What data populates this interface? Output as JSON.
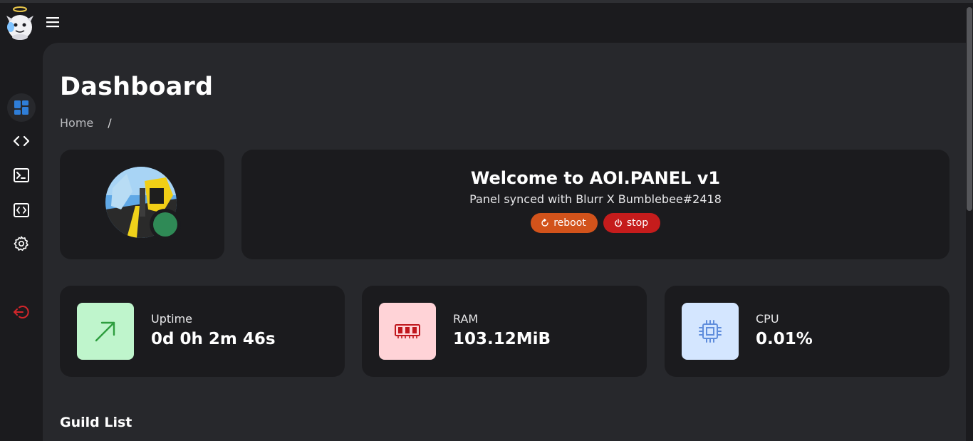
{
  "app": {
    "logo_name": "angel-bot-logo"
  },
  "topbar": {
    "menu_icon": "hamburger-menu-icon"
  },
  "sidebar": {
    "items": [
      {
        "name": "dashboard",
        "icon": "dashboard-grid-icon",
        "active": true
      },
      {
        "name": "code",
        "icon": "code-brackets-icon",
        "active": false
      },
      {
        "name": "terminal",
        "icon": "terminal-icon",
        "active": false
      },
      {
        "name": "code-editor",
        "icon": "code-file-icon",
        "active": false
      },
      {
        "name": "settings",
        "icon": "gear-icon",
        "active": false
      },
      {
        "name": "logout",
        "icon": "logout-icon",
        "active": false
      }
    ]
  },
  "page": {
    "title": "Dashboard",
    "breadcrumb": {
      "home": "Home",
      "separator": "/"
    }
  },
  "profile": {
    "status": "online",
    "status_color": "#2f8a56"
  },
  "welcome": {
    "title": "Welcome to AOI.PANEL v1",
    "subtitle": "Panel synced with Blurr X Bumblebee#2418",
    "reboot_label": "reboot",
    "stop_label": "stop",
    "reboot_color": "#d2531b",
    "stop_color": "#c51c1c"
  },
  "stats": [
    {
      "label": "Uptime",
      "value": "0d 0h 2m 46s",
      "icon": "trending-up-icon",
      "bg": "#bff5cc",
      "fg": "#2e9e3f"
    },
    {
      "label": "RAM",
      "value": "103.12MiB",
      "icon": "memory-icon",
      "bg": "#ffd3d7",
      "fg": "#c0161c"
    },
    {
      "label": "CPU",
      "value": "0.01%",
      "icon": "cpu-chip-icon",
      "bg": "#d4e6ff",
      "fg": "#5f8ddc"
    }
  ],
  "guild_list": {
    "title": "Guild List"
  }
}
